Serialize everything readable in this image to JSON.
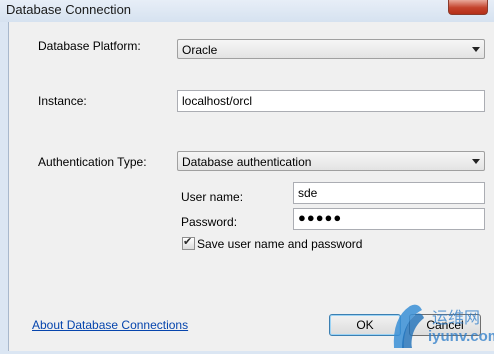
{
  "window": {
    "title": "Database Connection"
  },
  "platform": {
    "label": "Database Platform:",
    "value": "Oracle"
  },
  "instance": {
    "label": "Instance:",
    "value": "localhost/orcl"
  },
  "auth": {
    "label": "Authentication Type:",
    "value": "Database authentication",
    "username_label": "User name:",
    "username_value": "sde",
    "password_label": "Password:",
    "password_mask": "●●●●●",
    "save_label": "Save user name and password",
    "save_checked": true
  },
  "footer": {
    "about_link": "About Database Connections",
    "ok_label": "OK",
    "cancel_label": "Cancel"
  },
  "watermark": {
    "line1": "运维网",
    "line2": "iyunv.com"
  }
}
